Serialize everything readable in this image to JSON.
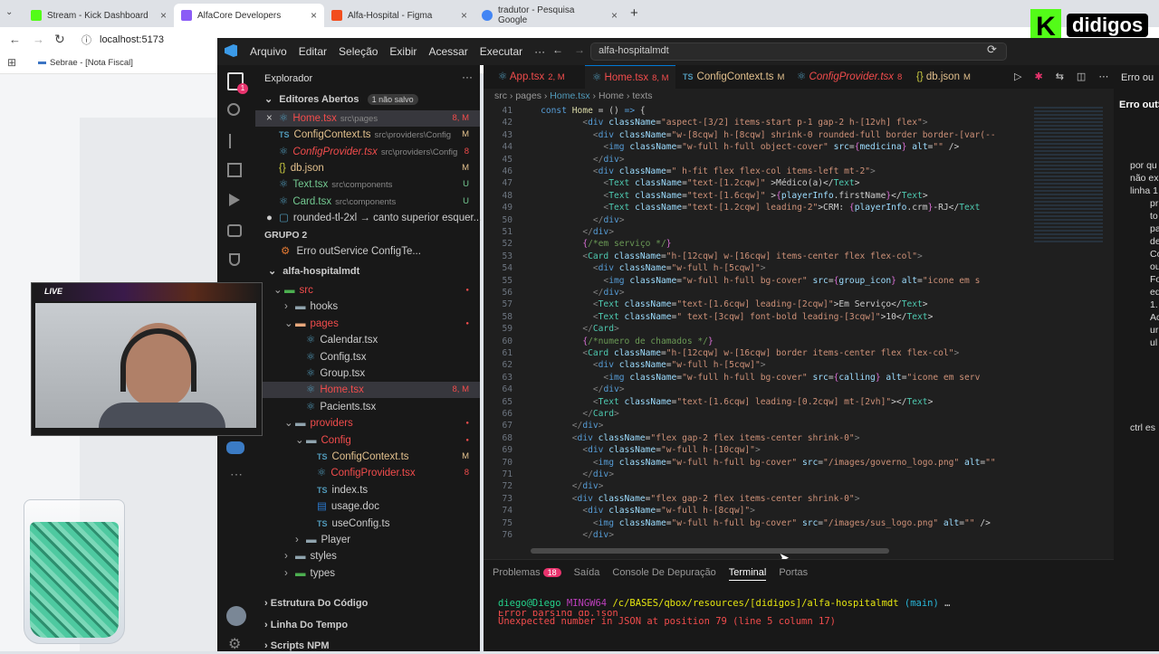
{
  "browser": {
    "tabs": [
      {
        "title": "Stream - Kick Dashboard",
        "color": "#53fc18"
      },
      {
        "title": "AlfaCore Developers",
        "color": "#8b5cf6"
      },
      {
        "title": "Alfa-Hospital - Figma",
        "color": "#f24e1e"
      },
      {
        "title": "tradutor - Pesquisa Google",
        "color": "#4285f4"
      }
    ],
    "new_tab": "+",
    "address": "localhost:5173",
    "bookmark": "Sebrae - [Nota Fiscal]"
  },
  "logo": {
    "letter": "K",
    "name": "didigos"
  },
  "webcam": {
    "live": "LIVE"
  },
  "vscode": {
    "menu": [
      "Arquivo",
      "Editar",
      "Seleção",
      "Exibir",
      "Acessar",
      "Executar",
      "···"
    ],
    "search": "alfa-hospitalmdt",
    "explorer_title": "Explorador",
    "explorer_more": "···",
    "open_editors": {
      "title": "Editores Abertos",
      "badge": "1 não salvo"
    },
    "open_files": [
      {
        "name": "Home.tsx",
        "path": "src\\pages",
        "status": "8, M",
        "cls": "err"
      },
      {
        "name": "ConfigContext.ts",
        "path": "src\\providers\\Config",
        "status": "M",
        "cls": "mod"
      },
      {
        "name": "ConfigProvider.tsx",
        "path": "src\\providers\\Config",
        "status": "8",
        "cls": "err"
      },
      {
        "name": "db.json",
        "path": "",
        "status": "M",
        "cls": "mod"
      },
      {
        "name": "Text.tsx",
        "path": "src\\components",
        "status": "U",
        "cls": "u"
      },
      {
        "name": "Card.tsx",
        "path": "src\\components",
        "status": "U",
        "cls": "u"
      },
      {
        "name": "rounded-tl-2xl → canto superior esquer...",
        "path": "",
        "status": "",
        "cls": "plain"
      }
    ],
    "group2": "GRUPO 2",
    "group2_file": "Erro outService ConfigTe...",
    "project": "alfa-hospitalmdt",
    "tree": [
      {
        "name": "src",
        "indent": 1,
        "kind": "folder-open",
        "cls": "err",
        "dot": true
      },
      {
        "name": "hooks",
        "indent": 2,
        "kind": "folder",
        "cls": "plain"
      },
      {
        "name": "pages",
        "indent": 2,
        "kind": "folder-open",
        "cls": "err",
        "dot": true
      },
      {
        "name": "Calendar.tsx",
        "indent": 3,
        "kind": "file",
        "cls": "plain"
      },
      {
        "name": "Config.tsx",
        "indent": 3,
        "kind": "file",
        "cls": "plain"
      },
      {
        "name": "Group.tsx",
        "indent": 3,
        "kind": "file",
        "cls": "plain"
      },
      {
        "name": "Home.tsx",
        "indent": 3,
        "kind": "file",
        "cls": "err",
        "status": "8, M"
      },
      {
        "name": "Pacients.tsx",
        "indent": 3,
        "kind": "file",
        "cls": "plain"
      },
      {
        "name": "providers",
        "indent": 2,
        "kind": "folder-open",
        "cls": "err",
        "dot": true
      },
      {
        "name": "Config",
        "indent": 3,
        "kind": "folder-open",
        "cls": "err",
        "dot": true
      },
      {
        "name": "ConfigContext.ts",
        "indent": 4,
        "kind": "ts",
        "cls": "mod",
        "status": "M"
      },
      {
        "name": "ConfigProvider.tsx",
        "indent": 4,
        "kind": "file",
        "cls": "err",
        "status": "8"
      },
      {
        "name": "index.ts",
        "indent": 4,
        "kind": "ts",
        "cls": "plain"
      },
      {
        "name": "usage.doc",
        "indent": 4,
        "kind": "doc",
        "cls": "plain"
      },
      {
        "name": "useConfig.ts",
        "indent": 4,
        "kind": "ts",
        "cls": "plain"
      },
      {
        "name": "Player",
        "indent": 3,
        "kind": "folder",
        "cls": "plain"
      },
      {
        "name": "styles",
        "indent": 2,
        "kind": "folder",
        "cls": "plain"
      },
      {
        "name": "types",
        "indent": 2,
        "kind": "folder",
        "cls": "plain"
      }
    ],
    "sections": [
      "Estrutura Do Código",
      "Linha Do Tempo",
      "Scripts NPM"
    ],
    "editor_tabs": [
      {
        "name": "App.tsx",
        "status": "2, M",
        "cls": "err"
      },
      {
        "name": "Home.tsx",
        "status": "8, M",
        "cls": "err",
        "active": true
      },
      {
        "name": "ConfigContext.ts",
        "status": "M",
        "cls": "mod"
      },
      {
        "name": "ConfigProvider.tsx",
        "status": "8",
        "cls": "err"
      },
      {
        "name": "db.json",
        "status": "M",
        "cls": "mod"
      }
    ],
    "breadcrumb": [
      "src",
      "pages",
      "Home.tsx",
      "Home",
      "texts"
    ],
    "right_panel": {
      "title": "Erro ou",
      "subtitle": "Erro outS",
      "lines": [
        "por qu",
        "não ex",
        "linha 1",
        "pr",
        "to",
        "pa",
        "de",
        "Co",
        "ou",
        "Fo",
        "ed",
        "1.",
        "Ac",
        "ur",
        "ul",
        "ctrl es"
      ]
    },
    "panel_tabs": [
      "Problemas",
      "Saída",
      "Console De Depuração",
      "Terminal",
      "Portas"
    ],
    "problems_count": "18",
    "terminal": {
      "prompt_user": "diego@Diego",
      "prompt_env": "MINGW64",
      "prompt_path": "/c/BASES/qbox/resources/[didigos]/alfa-hospitalmdt",
      "prompt_branch": "(main)",
      "prompt_tail": "…",
      "error_prev": "Error parsing db.json",
      "error_line": "Unexpected number in JSON at position 79 (line 5 column 17)"
    }
  },
  "code_lines": [
    {
      "n": "41",
      "html": "    <span class='k'>const</span> <span class='y'>Home</span> = () <span class='k'>=></span> {"
    },
    {
      "n": "42",
      "html": "            <span class='p'>&lt;</span><span class='k'>div</span> <span class='a'>className</span>=<span class='s'>\"aspect-[3/2] items-start p-1 gap-2 h-[12vh] flex\"</span><span class='p'>&gt;</span>"
    },
    {
      "n": "43",
      "html": "              <span class='p'>&lt;</span><span class='k'>div</span> <span class='a'>className</span>=<span class='s'>\"w-[8cqw] h-[8cqw] shrink-0 rounded-full border border-[var(--</span>"
    },
    {
      "n": "44",
      "html": "                <span class='p'>&lt;</span><span class='k'>img</span> <span class='a'>className</span>=<span class='s'>\"w-full h-full object-cover\"</span> <span class='a'>src</span>=<span class='b'>{</span><span class='a'>medicina</span><span class='b'>}</span> <span class='a'>alt</span>=<span class='s'>\"\"</span> /&gt;"
    },
    {
      "n": "45",
      "html": "              <span class='p'>&lt;/</span><span class='k'>div</span><span class='p'>&gt;</span>"
    },
    {
      "n": "46",
      "html": "              <span class='p'>&lt;</span><span class='k'>div</span> <span class='a'>className</span>=<span class='s'>\" h-fit flex flex-col items-left mt-2\"</span><span class='p'>&gt;</span>"
    },
    {
      "n": "47",
      "html": "                <span class='p'>&lt;</span><span class='t'>Text</span> <span class='a'>className</span>=<span class='s'>\"text-[1.2cqw]\"</span> &gt;Médico(a)&lt;/<span class='t'>Text</span>&gt;"
    },
    {
      "n": "48",
      "html": "                <span class='p'>&lt;</span><span class='t'>Text</span> <span class='a'>className</span>=<span class='s'>\"text-[1.6cqw]\"</span> &gt;<span class='b'>{</span><span class='a'>playerInfo</span>.firstName<span class='b'>}</span>&lt;/<span class='t'>Text</span>&gt;"
    },
    {
      "n": "49",
      "html": "                <span class='p'>&lt;</span><span class='t'>Text</span> <span class='a'>className</span>=<span class='s'>\"text-[1.2cqw] leading-2\"</span>&gt;CRM: <span class='b'>{</span><span class='a'>playerInfo</span>.crm<span class='b'>}</span>-RJ&lt;/<span class='t'>Text</span>"
    },
    {
      "n": "50",
      "html": "              <span class='p'>&lt;/</span><span class='k'>div</span><span class='p'>&gt;</span>"
    },
    {
      "n": "51",
      "html": "            <span class='p'>&lt;/</span><span class='k'>div</span><span class='p'>&gt;</span>"
    },
    {
      "n": "52",
      "html": "            <span class='b'>{</span><span class='c'>/*em serviço */</span><span class='b'>}</span>"
    },
    {
      "n": "53",
      "html": "            <span class='p'>&lt;</span><span class='t'>Card</span> <span class='a'>className</span>=<span class='s'>\"h-[12cqw] w-[16cqw] items-center flex flex-col\"</span><span class='p'>&gt;</span>"
    },
    {
      "n": "54",
      "html": "              <span class='p'>&lt;</span><span class='k'>div</span> <span class='a'>className</span>=<span class='s'>\"w-full h-[5cqw]\"</span><span class='p'>&gt;</span>"
    },
    {
      "n": "55",
      "html": "                <span class='p'>&lt;</span><span class='k'>img</span> <span class='a'>className</span>=<span class='s'>\"w-full h-full bg-cover\"</span> <span class='a'>src</span>=<span class='b'>{</span><span class='a'>group_icon</span><span class='b'>}</span> <span class='a'>alt</span>=<span class='s'>\"icone em s</span>"
    },
    {
      "n": "56",
      "html": "              <span class='p'>&lt;/</span><span class='k'>div</span><span class='p'>&gt;</span>"
    },
    {
      "n": "57",
      "html": "              <span class='p'>&lt;</span><span class='t'>Text</span> <span class='a'>className</span>=<span class='s'>\"text-[1.6cqw] leading-[2cqw]\"</span>&gt;Em Serviço&lt;/<span class='t'>Text</span>&gt;"
    },
    {
      "n": "58",
      "html": "              <span class='p'>&lt;</span><span class='t'>Text</span> <span class='a'>className</span>=<span class='s'>\" text-[3cqw] font-bold leading-[3cqw]\"</span>&gt;10&lt;/<span class='t'>Text</span>&gt;"
    },
    {
      "n": "59",
      "html": "            <span class='p'>&lt;/</span><span class='t'>Card</span><span class='p'>&gt;</span>"
    },
    {
      "n": "60",
      "html": "            <span class='b'>{</span><span class='c'>/*numero de chamados */</span><span class='b'>}</span>"
    },
    {
      "n": "61",
      "html": "            <span class='p'>&lt;</span><span class='t'>Card</span> <span class='a'>className</span>=<span class='s'>\"h-[12cqw] w-[16cqw] border items-center flex flex-col\"</span><span class='p'>&gt;</span>"
    },
    {
      "n": "62",
      "html": "              <span class='p'>&lt;</span><span class='k'>div</span> <span class='a'>className</span>=<span class='s'>\"w-full h-[5cqw]\"</span><span class='p'>&gt;</span>"
    },
    {
      "n": "63",
      "html": "                <span class='p'>&lt;</span><span class='k'>img</span> <span class='a'>className</span>=<span class='s'>\"w-full h-full bg-cover\"</span> <span class='a'>src</span>=<span class='b'>{</span><span class='a'>calling</span><span class='b'>}</span> <span class='a'>alt</span>=<span class='s'>\"icone em serv</span>"
    },
    {
      "n": "64",
      "html": "              <span class='p'>&lt;/</span><span class='k'>div</span><span class='p'>&gt;</span>"
    },
    {
      "n": "65",
      "html": "              <span class='p'>&lt;</span><span class='t'>Text</span> <span class='a'>className</span>=<span class='s'>\"text-[1.6cqw] leading-[0.2cqw] mt-[2vh]\"</span>&gt;&lt;/<span class='t'>Text</span>&gt;"
    },
    {
      "n": "66",
      "html": "            <span class='p'>&lt;/</span><span class='t'>Card</span><span class='p'>&gt;</span>"
    },
    {
      "n": "67",
      "html": "          <span class='p'>&lt;/</span><span class='k'>div</span><span class='p'>&gt;</span>"
    },
    {
      "n": "68",
      "html": "          <span class='p'>&lt;</span><span class='k'>div</span> <span class='a'>className</span>=<span class='s'>\"flex gap-2 flex items-center shrink-0\"</span><span class='p'>&gt;</span>"
    },
    {
      "n": "69",
      "html": "            <span class='p'>&lt;</span><span class='k'>div</span> <span class='a'>className</span>=<span class='s'>\"w-full h-[10cqw]\"</span><span class='p'>&gt;</span>"
    },
    {
      "n": "70",
      "html": "              <span class='p'>&lt;</span><span class='k'>img</span> <span class='a'>className</span>=<span class='s'>\"w-full h-full bg-cover\"</span> <span class='a'>src</span>=<span class='s'>\"/images/governo_logo.png\"</span> <span class='a'>alt</span>=<span class='s'>\"\"</span>"
    },
    {
      "n": "71",
      "html": "            <span class='p'>&lt;/</span><span class='k'>div</span><span class='p'>&gt;</span>"
    },
    {
      "n": "72",
      "html": "          <span class='p'>&lt;/</span><span class='k'>div</span><span class='p'>&gt;</span>"
    },
    {
      "n": "73",
      "html": "          <span class='p'>&lt;</span><span class='k'>div</span> <span class='a'>className</span>=<span class='s'>\"flex gap-2 flex items-center shrink-0\"</span><span class='p'>&gt;</span>"
    },
    {
      "n": "74",
      "html": "            <span class='p'>&lt;</span><span class='k'>div</span> <span class='a'>className</span>=<span class='s'>\"w-full h-[8cqw]\"</span><span class='p'>&gt;</span>"
    },
    {
      "n": "75",
      "html": "              <span class='p'>&lt;</span><span class='k'>img</span> <span class='a'>className</span>=<span class='s'>\"w-full h-full bg-cover\"</span> <span class='a'>src</span>=<span class='s'>\"/images/sus_logo.png\"</span> <span class='a'>alt</span>=<span class='s'>\"\"</span> /&gt;"
    },
    {
      "n": "76",
      "html": "            <span class='p'>&lt;/</span><span class='k'>div</span><span class='p'>&gt;</span>"
    }
  ]
}
